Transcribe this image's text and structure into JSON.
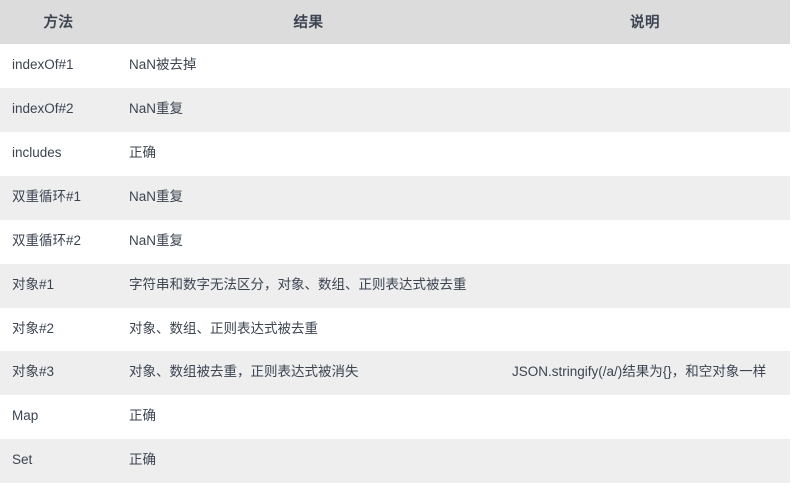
{
  "table": {
    "columns": [
      {
        "key": "method",
        "label": "方法"
      },
      {
        "key": "result",
        "label": "结果"
      },
      {
        "key": "desc",
        "label": "说明"
      }
    ],
    "colors": {
      "header_bg": "#dcdcdc",
      "row_odd_bg": "#ffffff",
      "row_even_bg": "#eeeeee",
      "text": "#3c4452"
    },
    "rows": [
      {
        "method": "indexOf#1",
        "result": "NaN被去掉",
        "desc": ""
      },
      {
        "method": "indexOf#2",
        "result": "NaN重复",
        "desc": ""
      },
      {
        "method": "includes",
        "result": "正确",
        "desc": ""
      },
      {
        "method": "双重循环#1",
        "result": "NaN重复",
        "desc": ""
      },
      {
        "method": "双重循环#2",
        "result": "NaN重复",
        "desc": ""
      },
      {
        "method": "对象#1",
        "result": "字符串和数字无法区分，对象、数组、正则表达式被去重",
        "desc": ""
      },
      {
        "method": "对象#2",
        "result": "对象、数组、正则表达式被去重",
        "desc": ""
      },
      {
        "method": "对象#3",
        "result": "对象、数组被去重，正则表达式被消失",
        "desc": "JSON.stringify(/a/)结果为{}，和空对象一样"
      },
      {
        "method": "Map",
        "result": "正确",
        "desc": ""
      },
      {
        "method": "Set",
        "result": "正确",
        "desc": ""
      }
    ]
  }
}
